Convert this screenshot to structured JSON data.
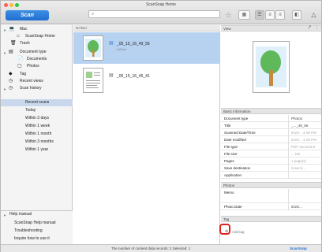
{
  "window": {
    "title": "ScanSnap Home"
  },
  "toolbar": {
    "scan_label": "Scan",
    "search_placeholder": "Search"
  },
  "sidebar": {
    "mac": "Mac",
    "scansnap_home": "ScanSnap Home",
    "trash": "Trash",
    "document_type": "Document type",
    "documents": "Documents",
    "photos": "Photos",
    "tag": "Tag",
    "recent_views": "Recent views",
    "scan_history": "Scan history",
    "history": [
      "Recent scans",
      "Today",
      "Within 3 days",
      "Within 1 week",
      "Within 1 month",
      "Within 3 months",
      "Within 1 year"
    ],
    "help_manual": "Help manual",
    "help_items": [
      "ScanSnap Help manual",
      "Troubleshooting",
      "Inquire how to use it"
    ]
  },
  "list": {
    "header": "NATaci",
    "items": [
      {
        "name": "_05_15_16_49_56",
        "sub": "NATaci"
      },
      {
        "name": "_05_15_16_45_41",
        "sub": ""
      }
    ]
  },
  "right": {
    "view_label": "View",
    "basic_label": "Basic information",
    "props": [
      {
        "k": "Document type",
        "v": "Photos"
      },
      {
        "k": "Title",
        "v": "_..._49_56"
      },
      {
        "k": "Scanned Date/Time",
        "v": "5/15/... 4:49 PM"
      },
      {
        "k": "Date modified",
        "v": "5/15/... 4:49 PM"
      },
      {
        "k": "File type",
        "v": "PDF document"
      },
      {
        "k": "File size",
        "v": "... KB"
      },
      {
        "k": "Pages",
        "v": "1 page(s)"
      },
      {
        "k": "Save destination",
        "v": "/Users/..."
      },
      {
        "k": "Application",
        "v": ""
      }
    ],
    "photos_label": "Photos",
    "photo_props": [
      {
        "k": "Memo",
        "v": ""
      },
      {
        "k": "Photo Date",
        "v": "5/15/..."
      }
    ],
    "tag_label": "Tag",
    "add_tag": "Add tag"
  },
  "status": {
    "text": "The number of content data records: 2  Selected: 1",
    "brand": "ScanSnap"
  },
  "colors": {
    "accent": "#1f6ed1",
    "selection": "#b7d1f0",
    "highlight": "#e0201c"
  }
}
